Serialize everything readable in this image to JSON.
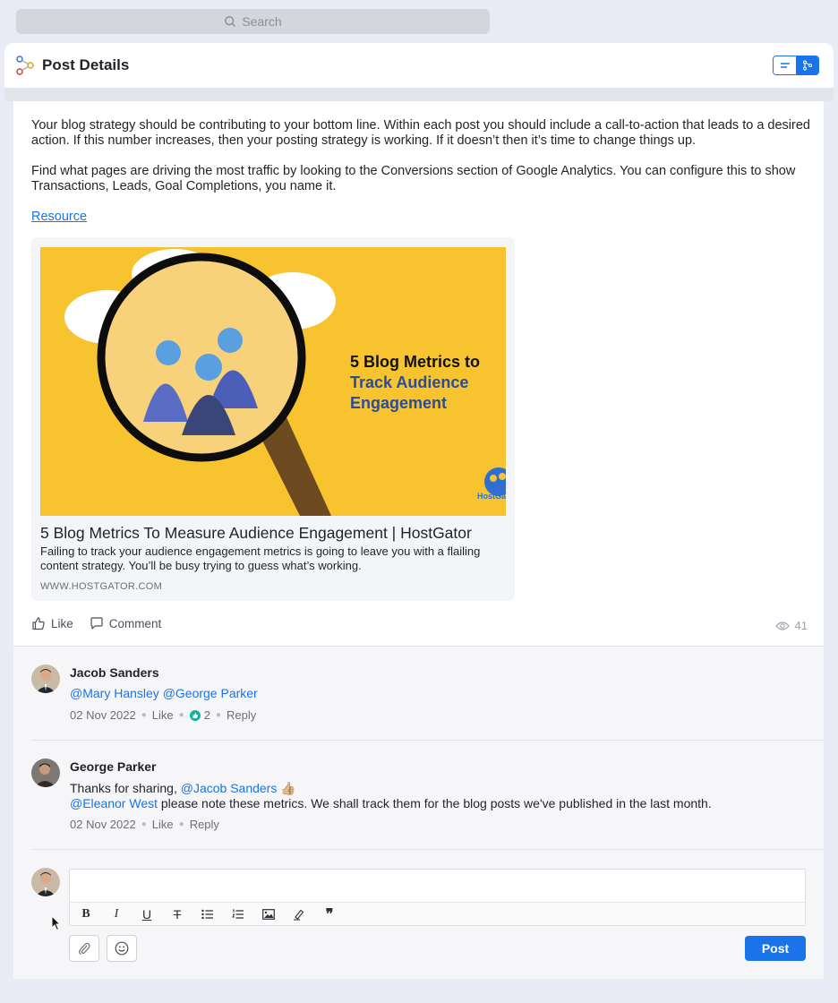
{
  "search": {
    "placeholder": "Search"
  },
  "header": {
    "title": "Post Details",
    "logo_icon": "workflow-icon",
    "accent": "#1a73e8"
  },
  "post": {
    "paragraphs": [
      "Your blog strategy should be contributing to your bottom line. Within each post you should include a call-to-action that leads to a desired action. If this number increases, then your posting strategy is working. If it doesn’t then it’s time to change things up.",
      "Find what pages are driving the most traffic by looking to the Conversions section of Google Analytics. You can configure this to show Transactions, Leads, Goal Completions, you name it."
    ],
    "resource_link": "Resource",
    "link_card": {
      "image_headline_1": "5 Blog Metrics to",
      "image_headline_2": "Track Audience",
      "image_headline_3": "Engagement",
      "image_brand": "HostGator",
      "title": "5 Blog Metrics To Measure Audience Engagement | HostGator",
      "description": "Failing to track your audience engagement metrics is going to leave you with a flailing content strategy. You’ll be busy trying to guess what’s working.",
      "domain": "WWW.HOSTGATOR.COM"
    },
    "actions": {
      "like": "Like",
      "comment": "Comment",
      "views": "41"
    }
  },
  "comments": [
    {
      "author": "Jacob Sanders",
      "mentions": [
        "@Mary Hansley",
        "@George Parker"
      ],
      "date": "02 Nov 2022",
      "like": "Like",
      "reaction_count": "2",
      "reply": "Reply"
    },
    {
      "author": "George Parker",
      "line1_text": "Thanks for sharing, ",
      "line1_mention": "@Jacob Sanders",
      "line1_emoji": "👍🏼",
      "line2_mention": "@Eleanor West",
      "line2_text": " please note these metrics. We shall track them for the blog posts we've published in the last month.",
      "date": "02 Nov 2022",
      "like": "Like",
      "reply": "Reply"
    }
  ],
  "composer": {
    "placeholder": "",
    "toolbar": [
      "bold-icon",
      "italic-icon",
      "underline-icon",
      "strikethrough-icon",
      "bullet-list-icon",
      "numbered-list-icon",
      "image-icon",
      "highlight-icon",
      "quote-icon"
    ],
    "post_label": "Post"
  }
}
